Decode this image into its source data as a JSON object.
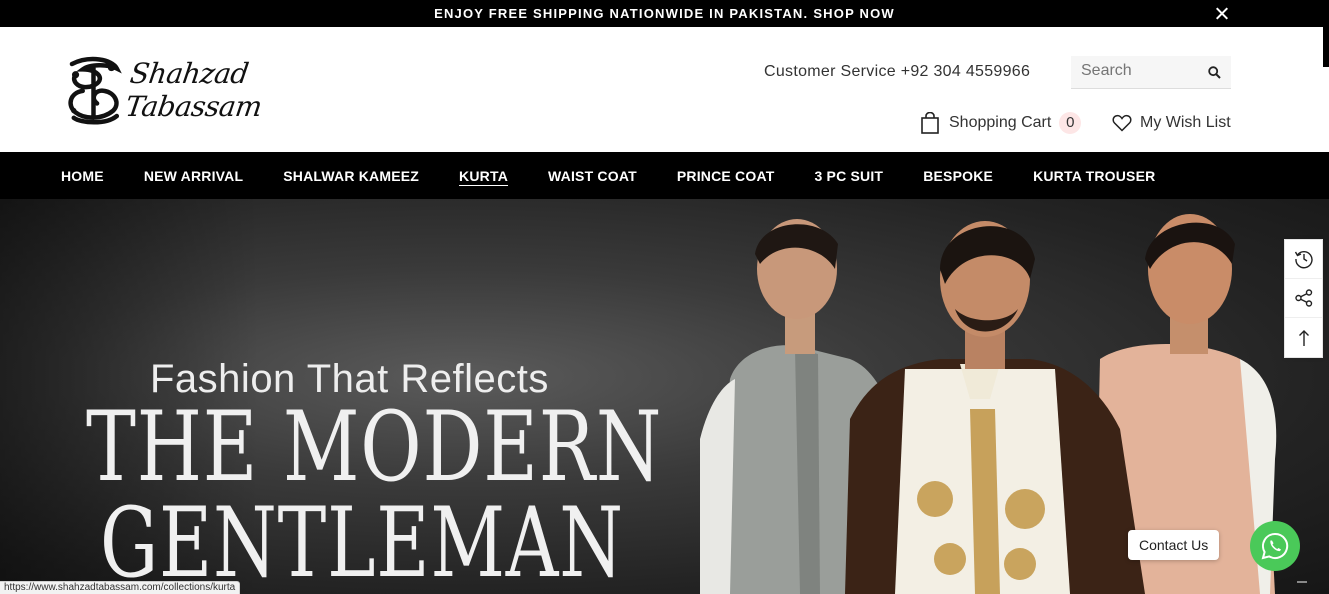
{
  "announcement": {
    "text": "ENJOY FREE SHIPPING NATIONWIDE IN PAKISTAN.",
    "link": "SHOP NOW"
  },
  "header": {
    "logo_text": "Shahzad Tabassam",
    "customer_service": "Customer Service +92 304 4559966",
    "search": {
      "placeholder": "Search"
    },
    "cart": {
      "label": "Shopping Cart",
      "count": "0"
    },
    "wishlist": {
      "label": "My Wish List"
    }
  },
  "nav": {
    "items": [
      {
        "label": "HOME"
      },
      {
        "label": "NEW ARRIVAL"
      },
      {
        "label": "SHALWAR KAMEEZ"
      },
      {
        "label": "KURTA"
      },
      {
        "label": "WAIST COAT"
      },
      {
        "label": "PRINCE COAT"
      },
      {
        "label": "3 PC SUIT"
      },
      {
        "label": "BESPOKE"
      },
      {
        "label": "KURTA TROUSER"
      }
    ],
    "active": "KURTA"
  },
  "hero": {
    "tagline": "Fashion That Reflects",
    "headline_1": "THE MODERN",
    "headline_2": "GENTLEMAN"
  },
  "side_tools": [
    "history-icon",
    "share-icon",
    "back-to-top-icon"
  ],
  "contact": {
    "label": "Contact Us"
  },
  "status_bar": {
    "url": "https://www.shahzadtabassam.com/collections/kurta"
  },
  "colors": {
    "top_bar": "#000000",
    "nav_bar": "#000000",
    "cart_badge": "#fde6e6",
    "whatsapp": "#4ac959"
  }
}
